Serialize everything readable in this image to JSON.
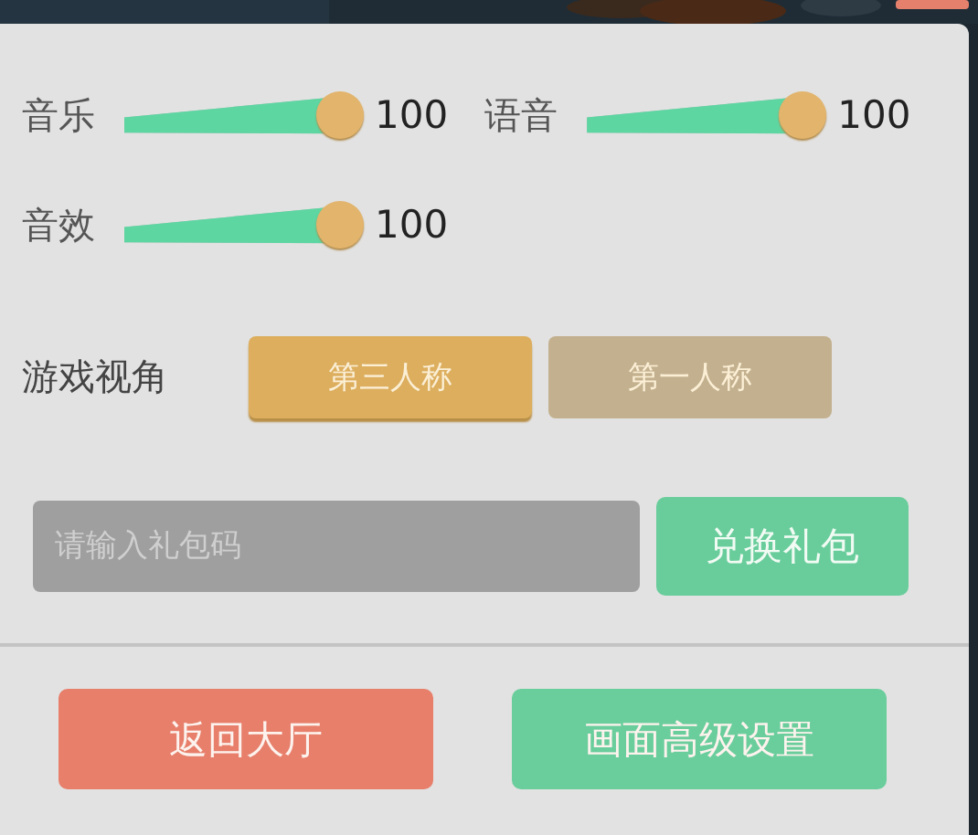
{
  "volumes": [
    {
      "label": "音乐",
      "level": 1,
      "reading": "100"
    },
    {
      "label": "语音",
      "level": 1,
      "reading": "100"
    },
    {
      "label": "音效",
      "level": 1,
      "reading": "100"
    }
  ],
  "view": {
    "label": "游戏视角",
    "options": [
      {
        "label": "第三人称",
        "selected": true
      },
      {
        "label": "第一人称",
        "selected": false
      }
    ]
  },
  "gift": {
    "placeholder": "请输入礼包码",
    "button": "兑换礼包"
  },
  "actions": [
    {
      "label": "返回大厅",
      "kind": "back"
    },
    {
      "label": "画面高级设置",
      "kind": "graphics"
    }
  ]
}
